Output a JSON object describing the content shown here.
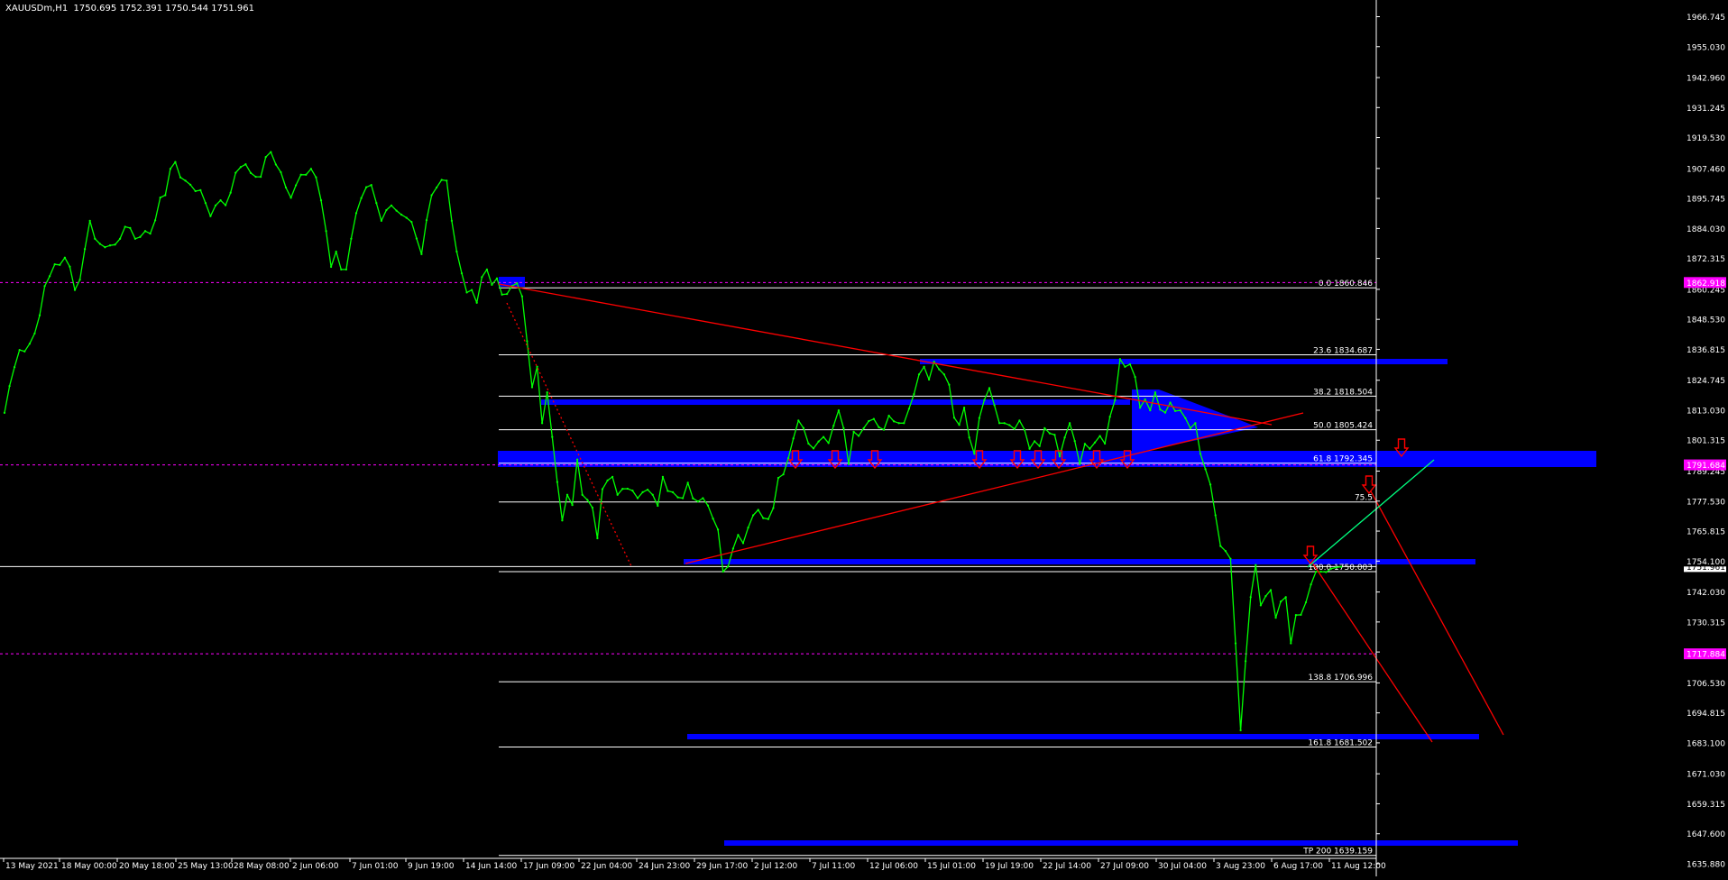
{
  "header": {
    "symbol": "XAUUSDm,H1",
    "ohlc": "1750.695 1752.391 1750.544 1751.961"
  },
  "colors": {
    "background": "#000000",
    "price_line": "#00ff00",
    "fib_line": "#ffffff",
    "zone": "#0000ff",
    "trendline": "#ff0000",
    "projection": "#00ff7f",
    "arrow": "#ff0000",
    "marker": "#ff00ff"
  },
  "chart_data": {
    "type": "line",
    "title": "XAUUSDm,H1",
    "ylim": [
      1635.88,
      1978.59
    ],
    "y_ticks": [
      1966.745,
      1955.03,
      1942.96,
      1931.245,
      1919.53,
      1907.46,
      1895.745,
      1884.03,
      1872.315,
      1860.245,
      1848.53,
      1836.815,
      1824.745,
      1813.03,
      1801.315,
      1789.245,
      1777.53,
      1765.815,
      1754.1,
      1742.03,
      1730.315,
      1718.6,
      1706.53,
      1694.815,
      1683.1,
      1671.03,
      1659.315,
      1647.6,
      1635.88
    ],
    "x_labels": [
      "13 May 2021",
      "18 May 00:00",
      "20 May 18:00",
      "25 May 13:00",
      "28 May 08:00",
      "2 Jun 06:00",
      "7 Jun 01:00",
      "9 Jun 19:00",
      "14 Jun 14:00",
      "17 Jun 09:00",
      "22 Jun 04:00",
      "24 Jun 23:00",
      "29 Jun 17:00",
      "2 Jul 12:00",
      "7 Jul 11:00",
      "12 Jul 06:00",
      "15 Jul 01:00",
      "19 Jul 19:00",
      "22 Jul 14:00",
      "27 Jul 09:00",
      "30 Jul 04:00",
      "3 Aug 23:00",
      "6 Aug 17:00",
      "11 Aug 12:00"
    ],
    "series": [
      {
        "values": [
          1812.0,
          1822.5,
          1829.9,
          1836.6,
          1836.0,
          1839.0,
          1843.0,
          1850.1,
          1861.5,
          1865.4,
          1870.0,
          1869.8,
          1872.6,
          1869.1,
          1860.0,
          1864.0,
          1876.0,
          1887.0,
          1880.0,
          1878.0,
          1876.7,
          1877.4,
          1877.7,
          1880.0,
          1884.7,
          1884.2,
          1880.0,
          1880.7,
          1883.0,
          1882.0,
          1887.2,
          1896.1,
          1897.0,
          1907.3,
          1910.0,
          1904.0,
          1902.7,
          1901.1,
          1898.6,
          1899.0,
          1894.0,
          1888.8,
          1893.0,
          1895.0,
          1893.1,
          1898.0,
          1905.8,
          1908.0,
          1909.1,
          1905.7,
          1904.2,
          1904.2,
          1911.9,
          1913.9,
          1909.0,
          1906.0,
          1900.0,
          1896.0,
          1900.9,
          1905.0,
          1905.0,
          1907.3,
          1904.0,
          1895.0,
          1883.0,
          1869.0,
          1875.0,
          1868.0,
          1868.0,
          1880.0,
          1890.0,
          1895.9,
          1900.1,
          1901.0,
          1894.0,
          1887.0,
          1891.2,
          1893.0,
          1891.0,
          1889.4,
          1888.2,
          1886.6,
          1880.1,
          1874.0,
          1887.3,
          1897.0,
          1900.0,
          1903.0,
          1902.7,
          1887.0,
          1875.0,
          1866.5,
          1859.0,
          1860.0,
          1855.0,
          1865.0,
          1868.0,
          1862.0,
          1864.5,
          1858.2,
          1858.4,
          1861.6,
          1862.6,
          1857.5,
          1840.0,
          1822.0,
          1830.0,
          1808.0,
          1820.0,
          1802.6,
          1785.0,
          1770.0,
          1780.0,
          1776.0,
          1793.8,
          1780.0,
          1778.0,
          1775.0,
          1763.0,
          1782.2,
          1785.6,
          1787.0,
          1780.0,
          1782.3,
          1782.4,
          1781.6,
          1778.7,
          1781.0,
          1782.0,
          1780.0,
          1775.7,
          1787.0,
          1781.5,
          1781.0,
          1779.0,
          1778.7,
          1784.7,
          1778.6,
          1777.4,
          1778.7,
          1775.8,
          1770.7,
          1766.4,
          1750.0,
          1752.0,
          1759.0,
          1764.3,
          1761.1,
          1767.2,
          1772.0,
          1774.1,
          1770.9,
          1770.5,
          1774.8,
          1786.6,
          1788.0,
          1794.3,
          1802.0,
          1809.0,
          1806.1,
          1800.0,
          1798.1,
          1800.8,
          1802.6,
          1800.2,
          1807.0,
          1813.0,
          1806.0,
          1792.0,
          1804.6,
          1803.0,
          1806.0,
          1808.8,
          1809.6,
          1806.4,
          1805.4,
          1810.9,
          1808.7,
          1808.0,
          1808.0,
          1813.6,
          1819.3,
          1827.0,
          1830.0,
          1825.0,
          1832.0,
          1829.0,
          1827.0,
          1823.0,
          1810.1,
          1807.3,
          1814.0,
          1802.4,
          1796.0,
          1810.0,
          1817.0,
          1821.7,
          1815.0,
          1808.0,
          1808.0,
          1807.2,
          1805.7,
          1809.0,
          1805.4,
          1798.0,
          1800.9,
          1799.0,
          1806.0,
          1804.0,
          1803.4,
          1795.0,
          1802.4,
          1808.0,
          1801.0,
          1792.0,
          1799.9,
          1798.0,
          1800.4,
          1803.0,
          1800.0,
          1810.5,
          1817.0,
          1833.0,
          1830.0,
          1831.0,
          1826.0,
          1814.0,
          1817.3,
          1813.0,
          1820.0,
          1813.3,
          1812.1,
          1816.0,
          1812.7,
          1813.0,
          1810.0,
          1806.0,
          1808.0,
          1796.0,
          1790.0,
          1784.0,
          1772.0,
          1760.0,
          1758.0,
          1755.0,
          1722.0,
          1688.0,
          1715.0,
          1740.0,
          1752.6,
          1736.8,
          1740.4,
          1742.8,
          1732.0,
          1738.3,
          1740.0,
          1722.0,
          1733.0,
          1733.1,
          1738.0,
          1745.0,
          1750.0,
          1750.0,
          1749.8,
          1751.1,
          1751.6,
          1751.9
        ]
      }
    ],
    "fib_levels": [
      {
        "label": "0.0 1860.846",
        "value": 1860.846
      },
      {
        "label": "23.6 1834.687",
        "value": 1834.687
      },
      {
        "label": "38.2 1818.504",
        "value": 1818.504
      },
      {
        "label": "50.0 1805.424",
        "value": 1805.424
      },
      {
        "label": "61.8 1792.345",
        "value": 1792.345
      },
      {
        "label": "75.5",
        "value": 1777.2
      },
      {
        "label": "100.0 1750.003",
        "value": 1750.003
      },
      {
        "label": "138.8 1706.996",
        "value": 1706.996
      },
      {
        "label": "161.8 1681.502",
        "value": 1681.502
      },
      {
        "label": "TP 200 1639.159",
        "value": 1639.159
      }
    ],
    "price_labels": [
      {
        "text": "1862.918",
        "value": 1862.918,
        "color": "#ff00ff"
      },
      {
        "text": "1791.684",
        "value": 1791.684,
        "color": "#ff00ff"
      },
      {
        "text": "1717.884",
        "value": 1717.884,
        "color": "#ff00ff"
      },
      {
        "text": "1751.961",
        "value": 1751.961,
        "color": "#ffffff"
      },
      {
        "text": "1754.100",
        "value": 1754.1,
        "color": "#000000"
      }
    ],
    "horizontal_lines": [
      {
        "value": 1862.918,
        "style": "dashed",
        "color": "#ff00ff"
      },
      {
        "value": 1791.684,
        "style": "dashed",
        "color": "#ff00ff"
      },
      {
        "value": 1717.884,
        "style": "dashed",
        "color": "#ff00ff"
      },
      {
        "value": 1751.961,
        "style": "solid",
        "color": "#ffffff"
      }
    ]
  }
}
